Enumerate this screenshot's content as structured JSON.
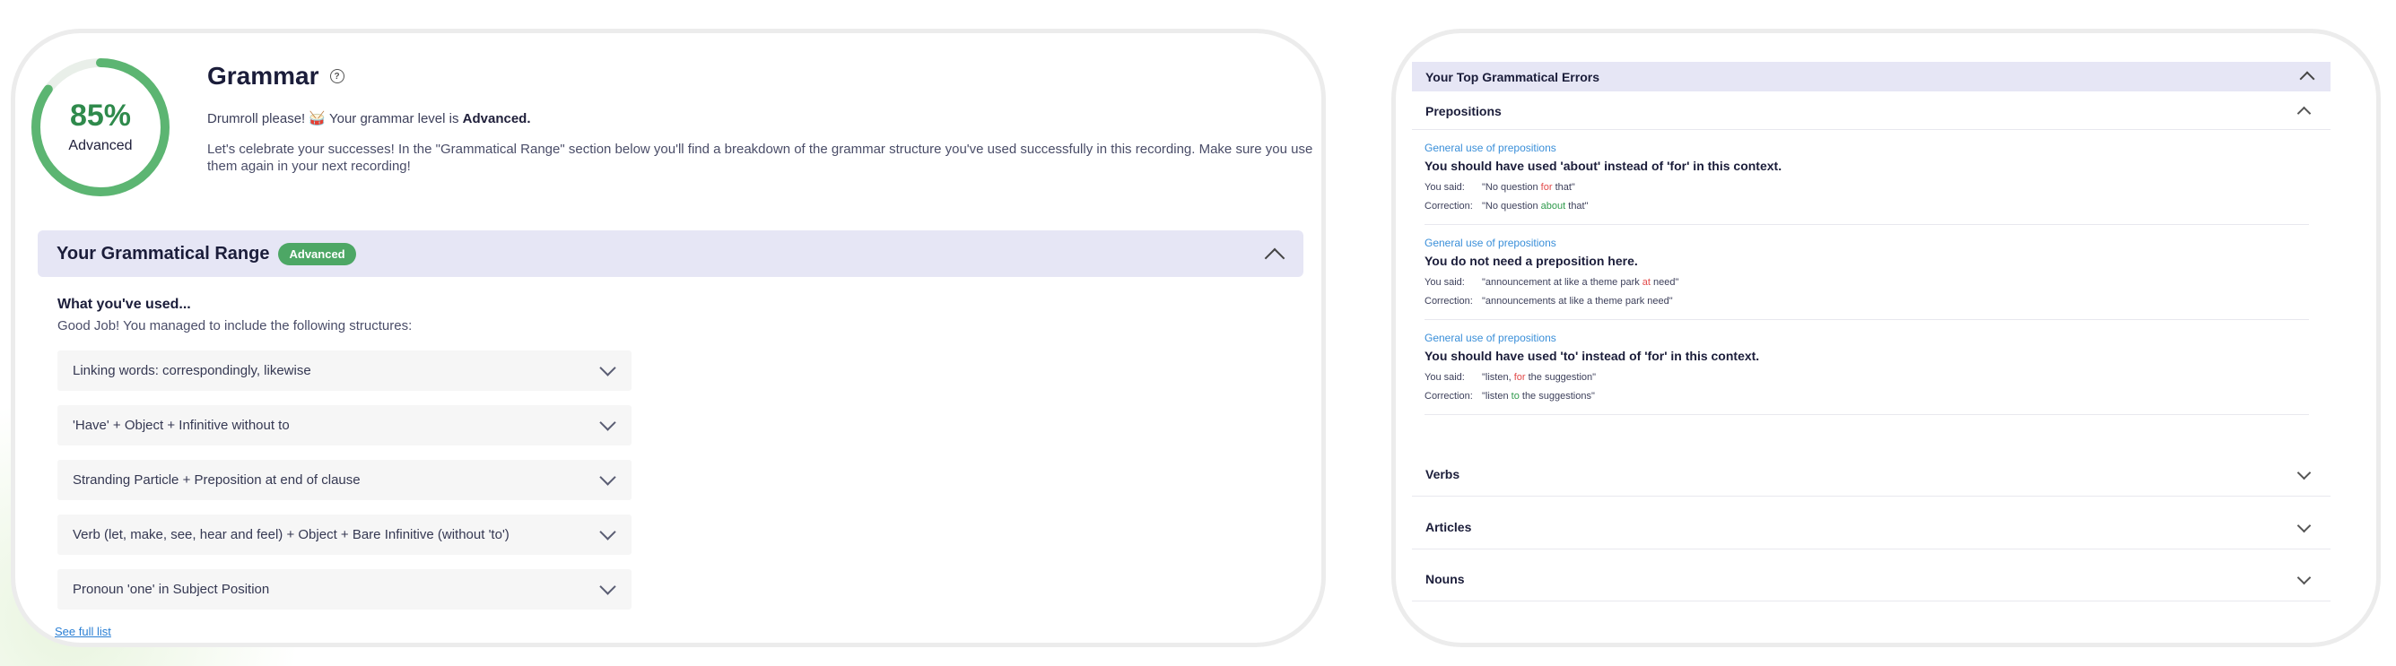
{
  "grammar": {
    "score_pct": "85%",
    "score_fraction": 0.85,
    "level": "Advanced",
    "title": "Grammar",
    "help_icon": "?",
    "line_prefix": "Drumroll please!",
    "line_emoji": "🥁",
    "line_mid": "Your grammar level is",
    "line_level": "Advanced.",
    "paragraph": "Let's celebrate your successes! In the \"Grammatical Range\" section below you'll find a breakdown of the grammar structure you've used successfully in this recording. Make sure you use them again in your next recording!"
  },
  "range": {
    "title": "Your Grammatical Range",
    "badge": "Advanced",
    "used_heading": "What you've used...",
    "used_sub": "Good Job! You managed to include the following structures:",
    "structures": [
      "Linking words: correspondingly, likewise",
      "'Have' + Object + Infinitive without to",
      "Stranding Particle + Preposition at end of clause",
      "Verb (let, make, see, hear and feel) + Object + Bare Infinitive (without 'to')",
      "Pronoun 'one' in Subject Position"
    ],
    "see_full": "See full list"
  },
  "errors": {
    "title": "Your Top Grammatical Errors",
    "categories": [
      "Prepositions",
      "Verbs",
      "Articles",
      "Nouns"
    ],
    "said_label": "You said:",
    "correction_label": "Correction:",
    "items": [
      {
        "type": "General use of prepositions",
        "message": "You should have used 'about' instead of 'for' in this context.",
        "said": [
          "\"No question ",
          "for",
          " that\""
        ],
        "correction": [
          "\"No question ",
          "about",
          " that\""
        ]
      },
      {
        "type": "General use of prepositions",
        "message": "You do not need a preposition here.",
        "said": [
          "\"announcement at like a theme park ",
          "at",
          " need\""
        ],
        "correction": [
          "\"announcements at like a theme park need\"",
          "",
          ""
        ]
      },
      {
        "type": "General use of prepositions",
        "message": "You should have used 'to' instead of 'for' in this context.",
        "said": [
          "\"listen, ",
          "for",
          " the suggestion\""
        ],
        "correction": [
          "\"listen ",
          "to",
          " the suggestions\""
        ]
      }
    ]
  },
  "colors": {
    "ring": "#5cb572",
    "ring_track": "#e9efe9",
    "accent_bar": "#e6e6f5",
    "badge": "#4da765",
    "link": "#2a7fd4",
    "wrong": "#e24a4a",
    "right": "#2f9a4c"
  }
}
